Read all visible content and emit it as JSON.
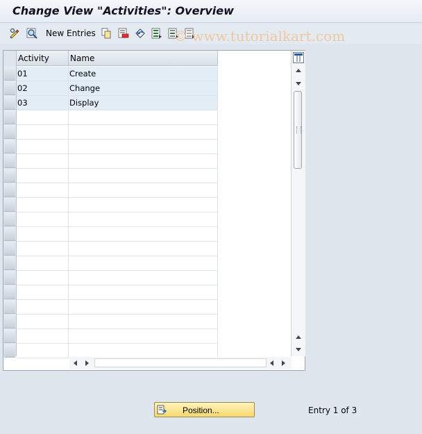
{
  "window": {
    "title": "Change View \"Activities\": Overview"
  },
  "toolbar": {
    "new_entries_label": "New Entries",
    "icons": [
      "display-change-icon",
      "search-icon",
      "copy-icon",
      "delete-icon",
      "undo-icon",
      "select-all-icon",
      "select-block-icon",
      "deselect-all-icon"
    ]
  },
  "watermark": "© www.tutorialkart.com",
  "table": {
    "columns": [
      "Activity",
      "Name"
    ],
    "rows": [
      {
        "activity": "01",
        "name": "Create"
      },
      {
        "activity": "02",
        "name": "Change"
      },
      {
        "activity": "03",
        "name": "Display"
      }
    ],
    "empty_rows": 17
  },
  "footer": {
    "position_label": "Position...",
    "entry_info": "Entry 1 of 3"
  }
}
